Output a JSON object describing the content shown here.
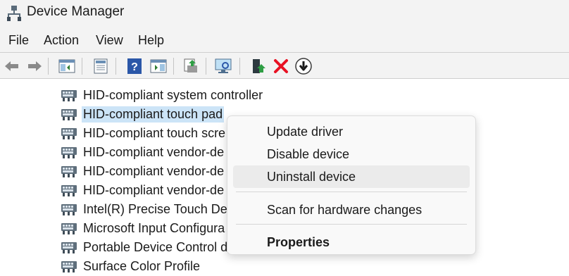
{
  "window": {
    "title": "Device Manager",
    "icon": "device-manager-icon"
  },
  "menu": {
    "file": "File",
    "action": "Action",
    "view": "View",
    "help": "Help"
  },
  "toolbar": {
    "buttons": [
      "back-arrow-icon",
      "forward-arrow-icon",
      "show-hide-console-tree-icon",
      "properties-sheet-icon",
      "help-icon",
      "action-pane-icon",
      "update-driver-icon",
      "scan-hardware-icon",
      "enable-device-icon",
      "uninstall-x-icon",
      "disable-device-icon"
    ],
    "uninstall_color": "#e81123"
  },
  "tree": {
    "items": [
      {
        "label": "HID-compliant system controller",
        "icon": "hid-device-icon",
        "selected": false
      },
      {
        "label": "HID-compliant touch pad",
        "icon": "hid-device-icon",
        "selected": true
      },
      {
        "label": "HID-compliant touch scre",
        "icon": "hid-device-icon",
        "selected": false
      },
      {
        "label": "HID-compliant vendor-de",
        "icon": "hid-device-icon",
        "selected": false
      },
      {
        "label": "HID-compliant vendor-de",
        "icon": "hid-device-icon",
        "selected": false
      },
      {
        "label": "HID-compliant vendor-de",
        "icon": "hid-device-icon",
        "selected": false
      },
      {
        "label": "Intel(R) Precise Touch Devi",
        "icon": "hid-device-icon",
        "selected": false
      },
      {
        "label": "Microsoft Input Configura",
        "icon": "hid-device-icon",
        "selected": false
      },
      {
        "label": "Portable Device Control de",
        "icon": "hid-device-icon",
        "selected": false
      },
      {
        "label": "Surface Color Profile",
        "icon": "hid-device-icon",
        "selected": false
      }
    ],
    "selection_color": "#cce4f7"
  },
  "context_menu": {
    "update_driver": "Update driver",
    "disable_device": "Disable device",
    "uninstall_device": "Uninstall device",
    "scan_hardware": "Scan for hardware changes",
    "properties": "Properties",
    "highlighted": "Uninstall device"
  }
}
